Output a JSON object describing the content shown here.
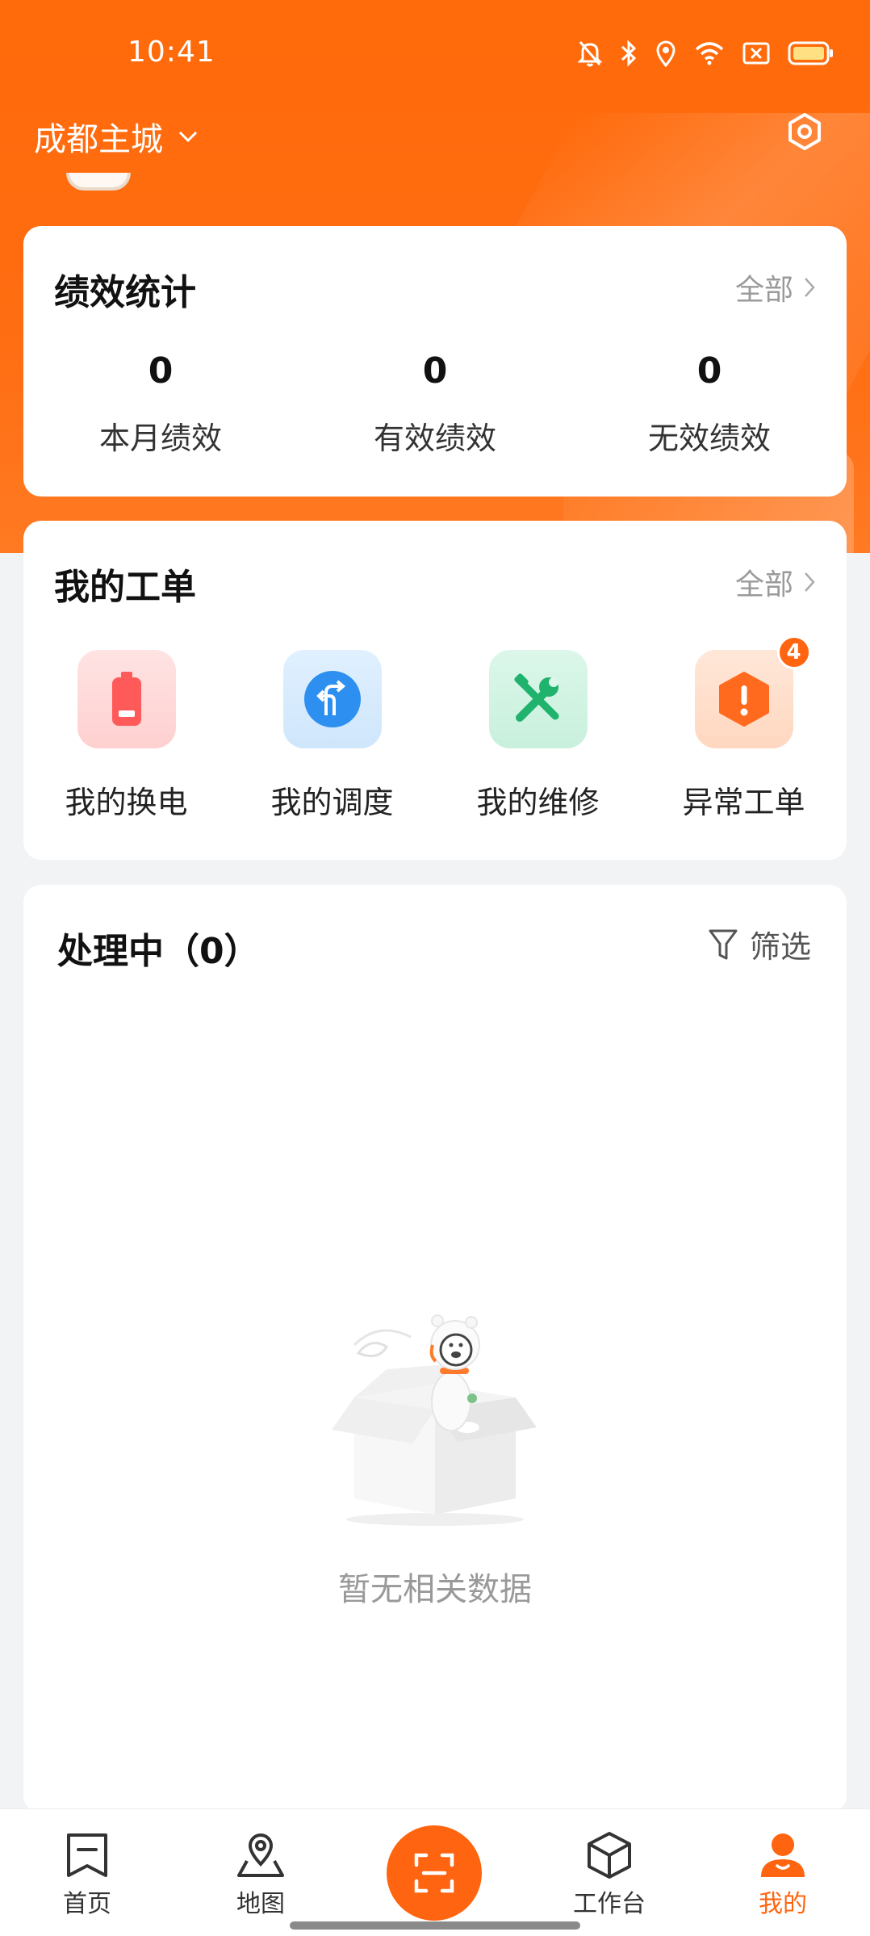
{
  "status_bar": {
    "time": "10:41"
  },
  "header": {
    "city": "成都主城"
  },
  "performance": {
    "title": "绩效统计",
    "more_label": "全部",
    "stats": [
      {
        "value": "0",
        "label": "本月绩效"
      },
      {
        "value": "0",
        "label": "有效绩效"
      },
      {
        "value": "0",
        "label": "无效绩效"
      }
    ]
  },
  "orders": {
    "title": "我的工单",
    "more_label": "全部",
    "items": [
      {
        "label": "我的换电",
        "icon": "battery-icon"
      },
      {
        "label": "我的调度",
        "icon": "dispatch-icon"
      },
      {
        "label": "我的维修",
        "icon": "repair-icon"
      },
      {
        "label": "异常工单",
        "icon": "warning-icon",
        "badge": "4"
      }
    ]
  },
  "processing": {
    "title": "处理中（0）",
    "filter_label": "筛选",
    "empty_text": "暂无相关数据"
  },
  "bottom_nav": {
    "items": [
      {
        "label": "首页",
        "icon": "home-flag-icon"
      },
      {
        "label": "地图",
        "icon": "map-icon"
      },
      {
        "label": "",
        "icon": "scan-icon"
      },
      {
        "label": "工作台",
        "icon": "workbench-icon"
      },
      {
        "label": "我的",
        "icon": "profile-icon",
        "active": true
      }
    ]
  },
  "colors": {
    "accent": "#ff6410",
    "background": "#f2f3f5"
  }
}
